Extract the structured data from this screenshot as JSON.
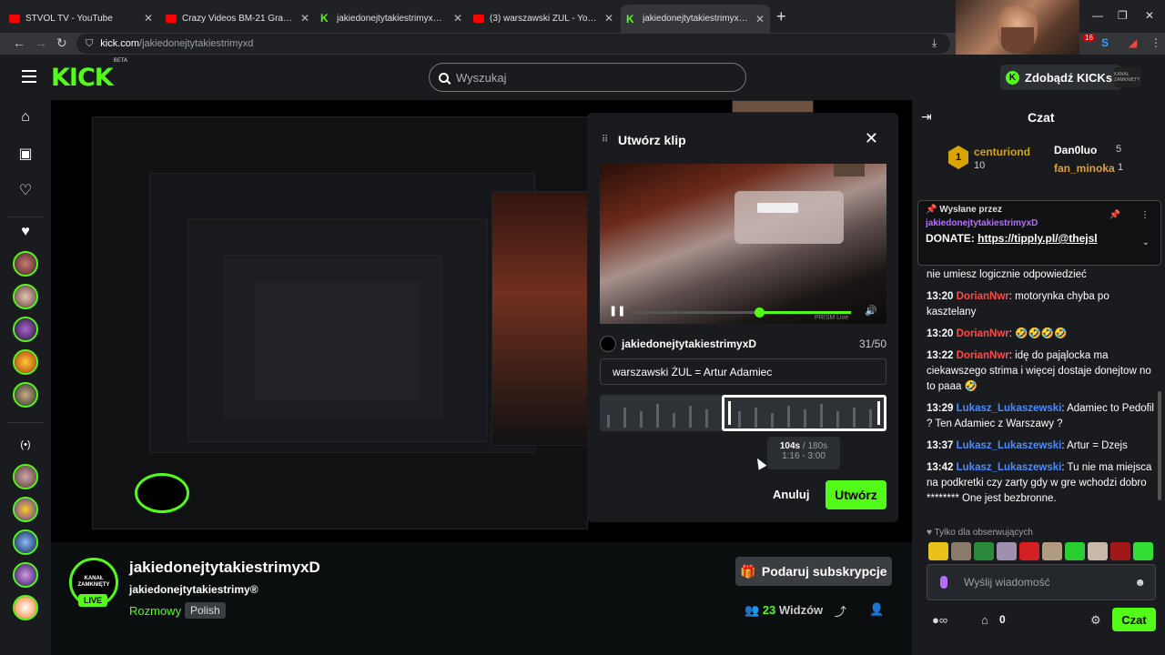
{
  "browser": {
    "tabs": [
      {
        "title": "STVOL TV - YouTube",
        "icon": "youtube-icon"
      },
      {
        "title": "Crazy Videos BM-21 Grad Large",
        "icon": "youtube-icon"
      },
      {
        "title": "jakiedonejtytakiestrimyxD Strea",
        "icon": "kick-icon"
      },
      {
        "title": "(3) warszawski ŻUL - YouTube",
        "icon": "youtube-icon"
      },
      {
        "title": "jakiedonejtytakiestrimyxD S",
        "icon": "kick-icon"
      }
    ],
    "url_host": "kick.com",
    "url_path": "/jakiedonejtytakiestrimyxd",
    "ext_badge": "16"
  },
  "header": {
    "logo": "KICK",
    "logo_sup": "BETA",
    "search_placeholder": "Wyszukaj",
    "get_kicks": "Zdobądź KICKs",
    "avatar_text": "KANAŁ ZAMKNIĘTY"
  },
  "clip_modal": {
    "title": "Utwórz klip",
    "username": "jakiedonejtytakiestrimyxD",
    "char_count": "31/50",
    "clip_title": "warszawski ŻUL = Artur Adamiec",
    "duration": "104s",
    "duration_max": "/ 180s",
    "range": "1:16 - 3:00",
    "watermark": "PRISM Live",
    "cancel": "Anuluj",
    "create": "Utwórz"
  },
  "stream": {
    "avatar_text": "KANAŁ ZAMKNIĘTY",
    "live": "LIVE",
    "name": "jakiedonejtytakiestrimyxD",
    "title": "jakiedonejtytakiestrimy®",
    "category": "Rozmowy",
    "tag": "Polish",
    "gift_label": "Podaruj subskrypcje",
    "viewers_count": "23",
    "viewers_label": "Widzów"
  },
  "chat": {
    "title": "Czat",
    "leaderboard": [
      {
        "name": "centuriond",
        "count": "10"
      },
      {
        "name": "Dan0luo",
        "count": "5"
      },
      {
        "name": "fan_minoka",
        "count": "1"
      }
    ],
    "pinned": {
      "label": "Wysłane przez",
      "user": "jakiedonejtytakiestrimyxD",
      "text_prefix": "DONATE:",
      "link": "https://tipply.pl/@thejsl"
    },
    "messages": [
      {
        "time": "",
        "user": "",
        "color": "#ffffff",
        "text": "nie umiesz logicznie odpowiedzieć"
      },
      {
        "time": "13:20",
        "user": "DorianNwr",
        "color": "#ff4a4a",
        "text": ": motorynka chyba po kasztelany"
      },
      {
        "time": "13:20",
        "user": "DorianNwr",
        "color": "#ff4a4a",
        "text": ": 🤣🤣🤣🤣"
      },
      {
        "time": "13:22",
        "user": "DorianNwr",
        "color": "#ff4a4a",
        "text": ": idę do pająlocka ma ciekawszego strima i więcej dostaje donejtow no to paaa 🤣"
      },
      {
        "time": "13:29",
        "user": "Lukasz_Lukaszewski",
        "color": "#4a8cff",
        "text": ": Adamiec to Pedofil ? Ten Adamiec z Warszawy ?"
      },
      {
        "time": "13:37",
        "user": "Lukasz_Lukaszewski",
        "color": "#4a8cff",
        "text": ": Artur = Dzejs"
      },
      {
        "time": "13:42",
        "user": "Lukasz_Lukaszewski",
        "color": "#4a8cff",
        "text": ": Tu nie ma miejsca na podkretki czy zarty gdy w gre wchodzi dobro ******** One jest bezbronne."
      }
    ],
    "followers_only": "Tylko dla obserwujących",
    "send_placeholder": "Wyślij wiadomość",
    "kicks_count": "0",
    "chat_button": "Czat"
  }
}
